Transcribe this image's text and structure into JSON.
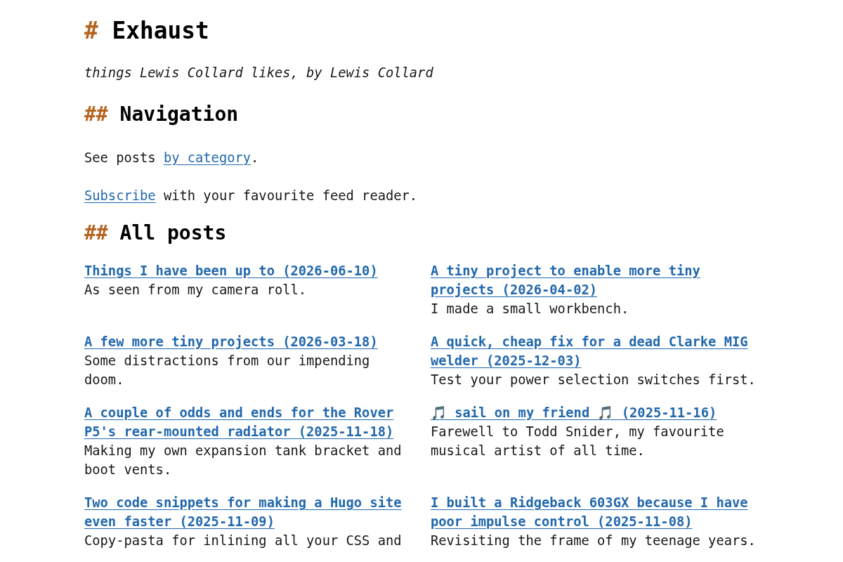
{
  "header": {
    "title": {
      "marker": "#",
      "text": "Exhaust"
    },
    "tagline": "things Lewis Collard likes, by Lewis Collard"
  },
  "navigation": {
    "heading": {
      "marker": "##",
      "text": "Navigation"
    },
    "paragraphs": [
      [
        {
          "kind": "text",
          "text": "See posts "
        },
        {
          "kind": "link",
          "text": "by category"
        },
        {
          "kind": "text",
          "text": "."
        }
      ],
      [
        {
          "kind": "link",
          "text": "Subscribe"
        },
        {
          "kind": "text",
          "text": " with your favourite feed reader."
        }
      ]
    ]
  },
  "all_posts": {
    "heading": {
      "marker": "##",
      "text": "All posts"
    },
    "posts": [
      {
        "title": "Things I have been up to (2026-06-10)",
        "summary": "As seen from my camera roll."
      },
      {
        "title": "A tiny project to enable more tiny projects (2026-04-02)",
        "summary": "I made a small workbench."
      },
      {
        "title": "A few more tiny projects (2026-03-18)",
        "summary": "Some distractions from our impending doom."
      },
      {
        "title": "A quick, cheap fix for a dead Clarke MIG welder (2025-12-03)",
        "summary": "Test your power selection switches first."
      },
      {
        "title": "A couple of odds and ends for the Rover P5's rear-mounted radiator (2025-11-18)",
        "summary": "Making my own expansion tank bracket and boot vents."
      },
      {
        "title": "🎵 sail on my friend 🎵 (2025-11-16)",
        "summary": "Farewell to Todd Snider, my favourite musical artist of all time."
      },
      {
        "title": "Two code snippets for making a Hugo site even faster (2025-11-09)",
        "summary": "Copy-pasta for inlining all your CSS and"
      },
      {
        "title": "I built a Ridgeback 603GX because I have poor impulse control (2025-11-08)",
        "summary": "Revisiting the frame of my teenage years."
      }
    ]
  }
}
